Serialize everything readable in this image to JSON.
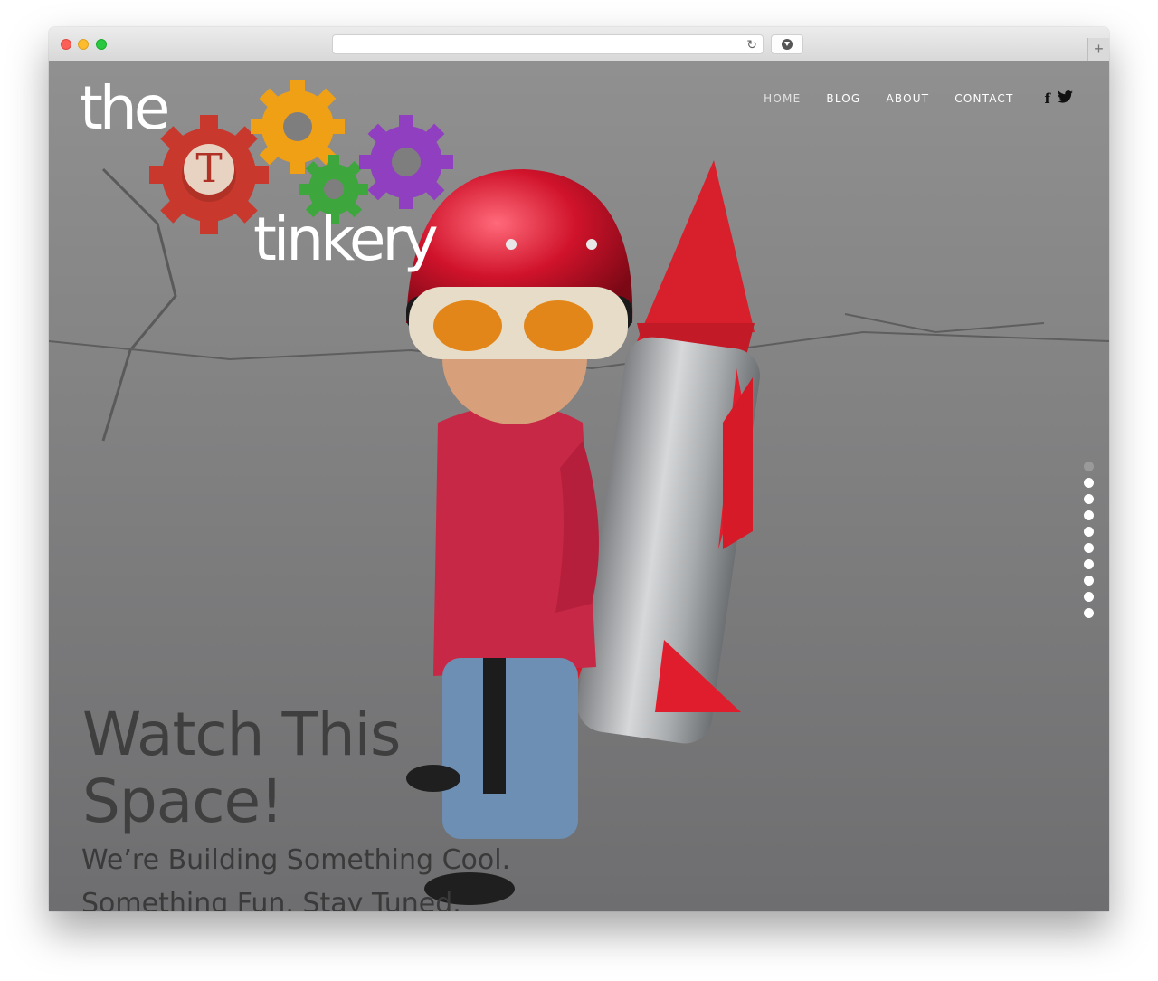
{
  "nav": {
    "items": [
      {
        "label": "HOME"
      },
      {
        "label": "BLOG"
      },
      {
        "label": "ABOUT"
      },
      {
        "label": "CONTACT"
      }
    ],
    "facebook": "f",
    "twitter": "𝕥"
  },
  "logo": {
    "the": "the",
    "tinkery": "tinkery",
    "gear_letter": "T",
    "colors": {
      "red": "#c8382d",
      "orange": "#f0a014",
      "green": "#3da63c",
      "purple": "#8f3fbf"
    }
  },
  "hero": {
    "headline_line1": "Watch This",
    "headline_line2": "Space!",
    "sub_line1": "We’re Building Something Cool.",
    "sub_line2": "Something Fun. Stay Tuned."
  },
  "slider": {
    "count": 10,
    "active_index": 0
  },
  "browser": {
    "reload_icon": "↻",
    "newtab_icon": "+"
  }
}
